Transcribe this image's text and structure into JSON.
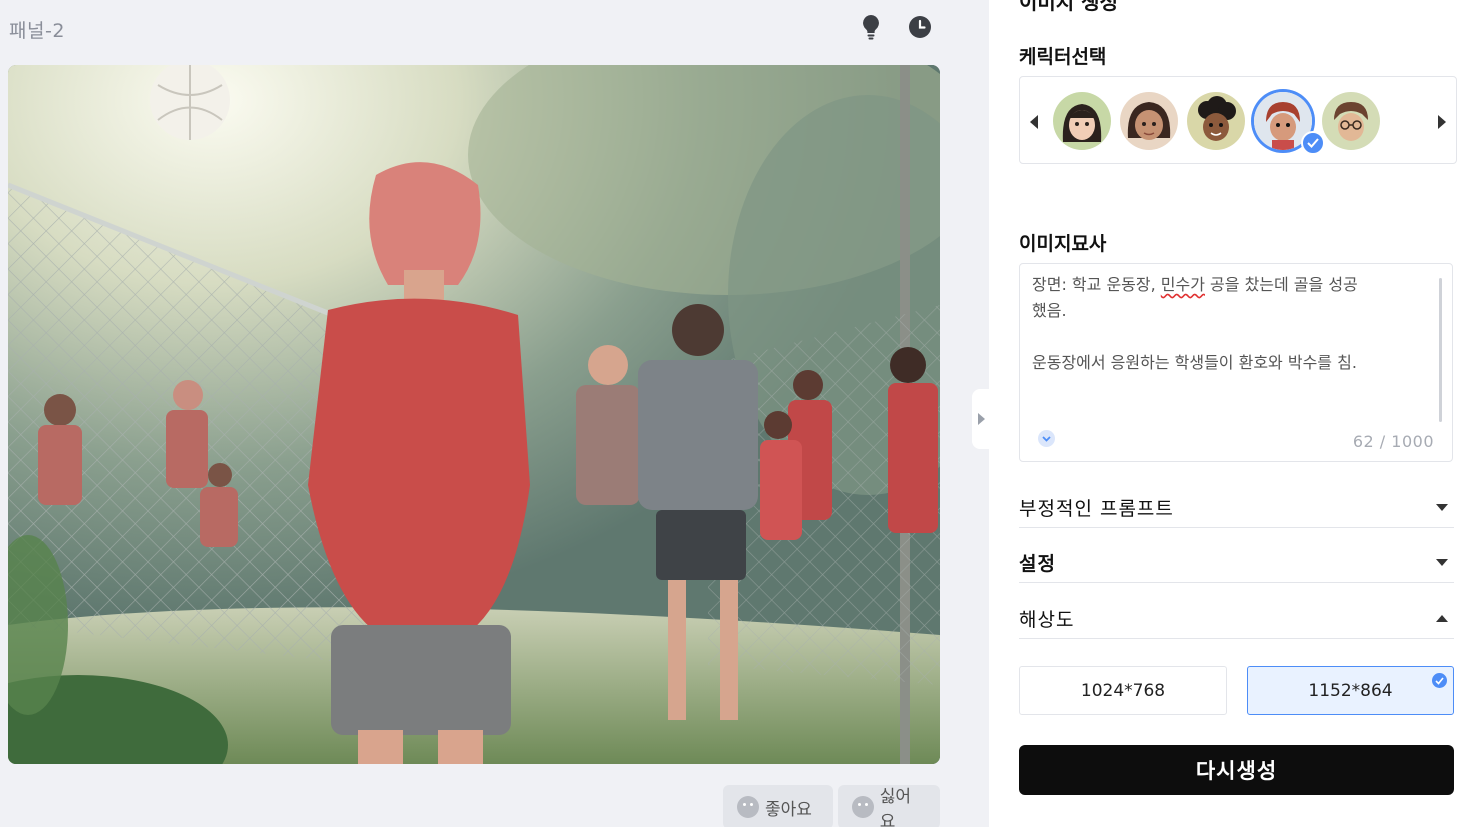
{
  "panel": {
    "title": "패널-2"
  },
  "right_panel": {
    "cut_heading": "이미지 생성",
    "character_section_label": "케릭터선택",
    "characters": [
      {
        "name": "girl-avatar-1"
      },
      {
        "name": "girl-avatar-2"
      },
      {
        "name": "boy-avatar-curly"
      },
      {
        "name": "boy-avatar-red-hair",
        "selected": true
      },
      {
        "name": "boy-avatar-glasses"
      }
    ],
    "description_label": "이미지묘사",
    "description": {
      "line1_prefix": "장면: 학교 운동장, ",
      "line1_misspelled": "민수가",
      "line1_suffix": " 공을 찼는데 골을 성공\n했음.\n\n운동장에서 응원하는 학생들이 환호와 박수를 침.",
      "counter": "62 / 1000"
    },
    "accordions": [
      {
        "label": "부정적인 프롬프트",
        "state": "collapsed"
      },
      {
        "label": "설정",
        "state": "collapsed"
      },
      {
        "label": "해상도",
        "state": "expanded"
      }
    ],
    "resolutions": [
      {
        "label": "1024*768",
        "selected": false
      },
      {
        "label": "1152*864",
        "selected": true
      }
    ],
    "regenerate_label": "다시생성"
  },
  "feedback": {
    "like_label": "좋아요",
    "dislike_label": "싫어요"
  },
  "colors": {
    "accent": "#4d8df7",
    "button_dark": "#0d0d0d",
    "panel_bg": "#f0f1f5"
  },
  "icons": [
    "lightbulb-icon",
    "clock-icon",
    "chevron-left-icon",
    "chevron-right-icon",
    "check-icon"
  ]
}
